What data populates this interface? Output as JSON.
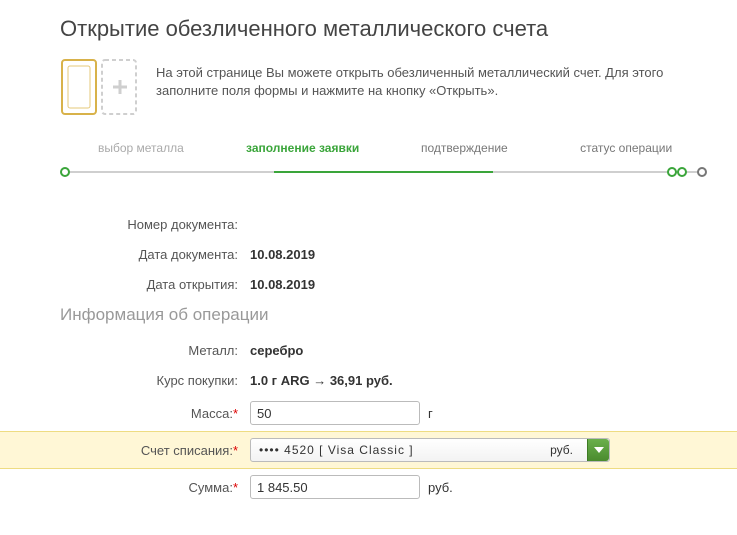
{
  "page_title": "Открытие обезличенного металлического счета",
  "info_text": "На этой странице Вы можете открыть обезличенный металлический счет. Для этого заполните поля формы и нажмите на кнопку «Открыть».",
  "stepper": {
    "steps": [
      "выбор металла",
      "заполнение заявки",
      "подтверждение",
      "статус операции"
    ],
    "active_index": 1
  },
  "section_title": "Информация об операции",
  "labels": {
    "doc_number": "Номер документа:",
    "doc_date": "Дата документа:",
    "open_date": "Дата открытия:",
    "metal": "Металл:",
    "rate": "Курс покупки:",
    "mass": "Масса:",
    "debit_account": "Счет списания:",
    "amount": "Сумма:"
  },
  "values": {
    "doc_number": "",
    "doc_date": "10.08.2019",
    "open_date": "10.08.2019",
    "metal": "серебро",
    "rate": "1.0 г  ARG → 36,91  руб.",
    "mass": "50",
    "mass_unit": "г",
    "debit_account": "•••• 4520   [ Visa Classic ]",
    "debit_ccy": "руб.",
    "amount": "1 845.50",
    "amount_unit": "руб."
  },
  "req_mark": "*"
}
